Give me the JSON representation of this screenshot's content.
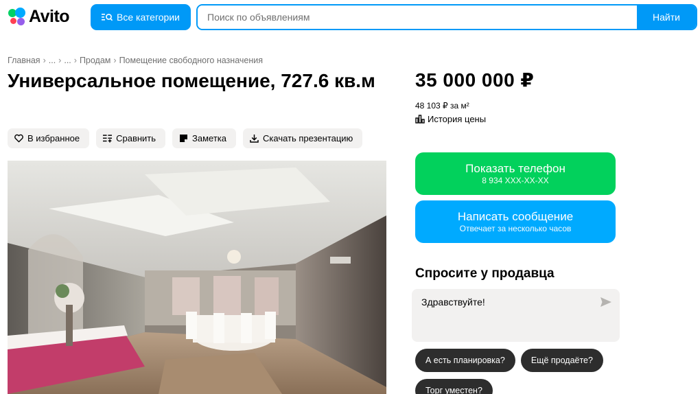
{
  "header": {
    "logo_text": "Avito",
    "categories_label": "Все категории",
    "search_placeholder": "Поиск по объявлениям",
    "search_button": "Найти"
  },
  "breadcrumb": [
    "Главная",
    "...",
    "...",
    "Продам",
    "Помещение свободного назначения"
  ],
  "listing": {
    "title": "Универсальное помещение, 727.6 кв.м",
    "price": "35 000 000 ₽",
    "price_per_m2": "48 103 ₽ за м²",
    "price_history": "История цены"
  },
  "actions": {
    "favorite": "В избранное",
    "compare": "Сравнить",
    "note": "Заметка",
    "download": "Скачать презентацию"
  },
  "contact": {
    "phone_label": "Показать телефон",
    "phone_number": "8 934 XXX-XX-XX",
    "message_label": "Написать сообщение",
    "message_sub": "Отвечает за несколько часов"
  },
  "ask": {
    "title": "Спросите у продавца",
    "message_value": "Здравствуйте!",
    "chips": [
      "А есть планировка?",
      "Ещё продаёте?",
      "Торг уместен?"
    ]
  },
  "colors": {
    "accent_blue": "#0099f7",
    "phone_green": "#02d15c",
    "message_blue": "#00aaff",
    "chip_dark": "#2d2d2d",
    "button_grey": "#f2f1f0"
  },
  "icons": {
    "favorite": "heart-icon",
    "compare": "compare-icon",
    "note": "note-icon",
    "download": "download-icon",
    "history": "chart-icon",
    "send": "send-icon",
    "categories": "search-list-icon"
  }
}
